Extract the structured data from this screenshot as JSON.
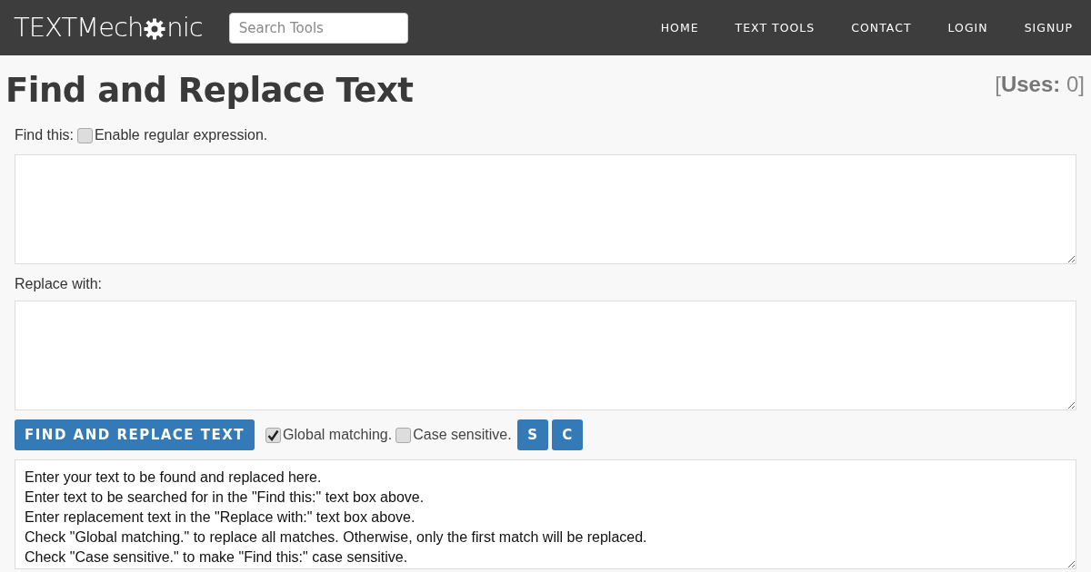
{
  "header": {
    "logo_before": "TEXTMech",
    "logo_after": "nic",
    "search": {
      "placeholder": "Search Tools"
    },
    "nav": [
      "HOME",
      "TEXT TOOLS",
      "CONTACT",
      "LOGIN",
      "SIGNUP"
    ]
  },
  "title": "Find and Replace Text",
  "uses": "[**Uses:** 0]",
  "find": {
    "label": "Find this:",
    "regex": {
      "label": "Enable regular expression.",
      "checked": false
    }
  },
  "replace": {
    "label": "Replace with:"
  },
  "actions": {
    "button": "FIND AND REPLACE TEXT",
    "options": [
      {
        "label": "Global matching.",
        "checked": true
      },
      {
        "label": "Case sensitive.",
        "checked": false
      }
    ],
    "small_buttons": [
      "S",
      "C"
    ]
  },
  "text": "Enter your text to be found and replaced here.\nEnter text to be searched for in the \"Find this:\" text box above.\nEnter replacement text in the \"Replace with:\" text box above.\nCheck \"Global matching.\" to replace all matches. Otherwise, only the first match will be replaced.\nCheck \"Case sensitive.\" to make \"Find this:\" case sensitive."
}
